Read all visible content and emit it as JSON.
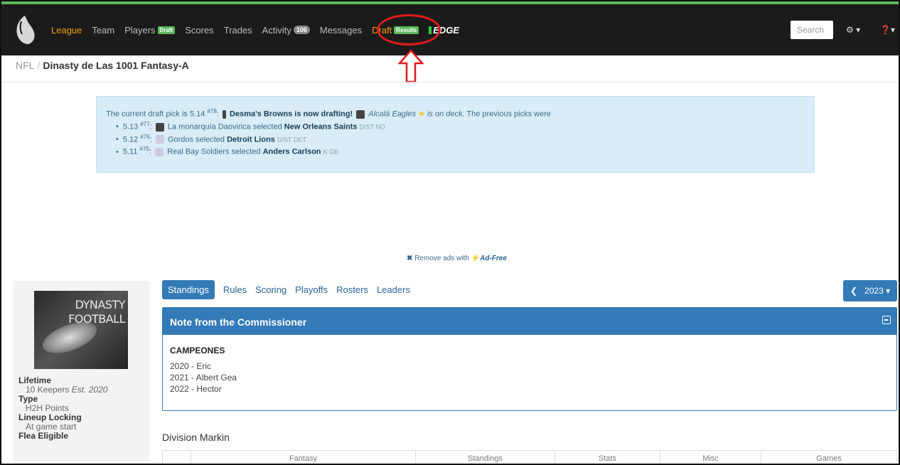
{
  "nav": {
    "items": [
      {
        "label": "League",
        "active": true
      },
      {
        "label": "Team"
      },
      {
        "label": "Players",
        "badge": "Draft"
      },
      {
        "label": "Scores"
      },
      {
        "label": "Trades"
      },
      {
        "label": "Activity",
        "count": "106"
      },
      {
        "label": "Messages"
      },
      {
        "label": "Draft",
        "badge": "Results",
        "highlighted": true
      },
      {
        "label": "EDGE"
      }
    ],
    "search_placeholder": "Search",
    "gear_icon": "gear-icon",
    "help_icon": "help-icon"
  },
  "breadcrumb": {
    "root": "NFL",
    "current": "Dinasty de Las 1001 Fantasy-A"
  },
  "draft_alert": {
    "intro": "The current draft pick is 5.14",
    "intro_num": "#78",
    "drafting": "Desma's Browns is now drafting!",
    "on_deck_team": "Alcalá Eagles",
    "on_deck_text": "is on deck.",
    "prev_text": "The previous picks were",
    "picks": [
      {
        "pick": "5.13",
        "num": "#77",
        "team": "La monarquía Daovirica",
        "player": "New Orleans Saints",
        "pos": "D/ST NO"
      },
      {
        "pick": "5.12",
        "num": "#76",
        "team": "Gordos",
        "player": "Detroit Lions",
        "pos": "D/ST DET"
      },
      {
        "pick": "5.11",
        "num": "#75",
        "team": "Real Bay Soldiers",
        "player": "Anders Carlson",
        "pos": "K GB"
      }
    ],
    "selected_word": "selected"
  },
  "ads": {
    "prefix": "Remove ads with",
    "product": "Ad-Free"
  },
  "league_image": {
    "line1": "DYNASTY",
    "line2": "FOOTBALL"
  },
  "league_meta": [
    {
      "label": "Lifetime",
      "value": "10 Keepers",
      "extra": "Est. 2020"
    },
    {
      "label": "Type",
      "value": "H2H Points"
    },
    {
      "label": "Lineup Locking",
      "value": "At game start"
    },
    {
      "label": "Flea Eligible",
      "value": ""
    }
  ],
  "tabs": [
    "Standings",
    "Rules",
    "Scoring",
    "Playoffs",
    "Rosters",
    "Leaders"
  ],
  "year": "2023",
  "note": {
    "title": "Note from the Commissioner",
    "heading": "CAMPEONES",
    "lines": [
      "2020 - Eric",
      "2021 - Albert Gea",
      "2022 - Hector"
    ]
  },
  "division": "Division Markin",
  "table_headers": [
    "",
    "Fantasy",
    "Standings",
    "Stats",
    "Misc",
    "Games"
  ]
}
